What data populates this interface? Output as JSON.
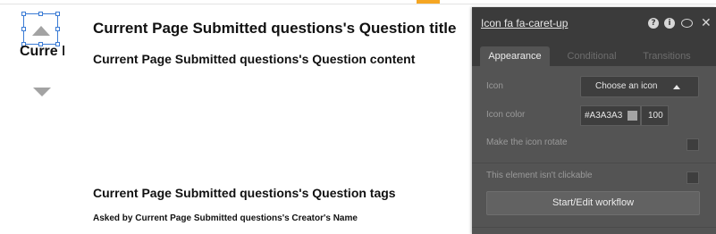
{
  "canvas": {
    "vote_count_text": "Curre Page.",
    "question_title": "Current Page Submitted questions's Question title",
    "question_content": "Current Page Submitted questions's Question content",
    "question_tags": "Current Page Submitted questions's Question tags",
    "asked_by": "Asked by Current Page Submitted questions's Creator's Name"
  },
  "panel": {
    "title": "Icon fa fa-caret-up",
    "header_icons": [
      "help-icon",
      "info-icon",
      "comment-icon",
      "close-icon"
    ],
    "tabs": [
      {
        "label": "Appearance",
        "active": true
      },
      {
        "label": "Conditional",
        "active": false
      },
      {
        "label": "Transitions",
        "active": false
      }
    ],
    "icon_label": "Icon",
    "icon_dropdown": "Choose an icon",
    "icon_color_label": "Icon color",
    "icon_color_value": "#A3A3A3",
    "icon_opacity": "100",
    "rotate_label": "Make the icon rotate",
    "rotate_checked": false,
    "not_clickable_label": "This element isn't clickable",
    "not_clickable_checked": false,
    "workflow_button": "Start/Edit workflow"
  },
  "colors": {
    "icon_color": "#A3A3A3",
    "selection": "#3A7BD5",
    "panel_bg": "#545454",
    "accent_marker": "#F5A623"
  }
}
